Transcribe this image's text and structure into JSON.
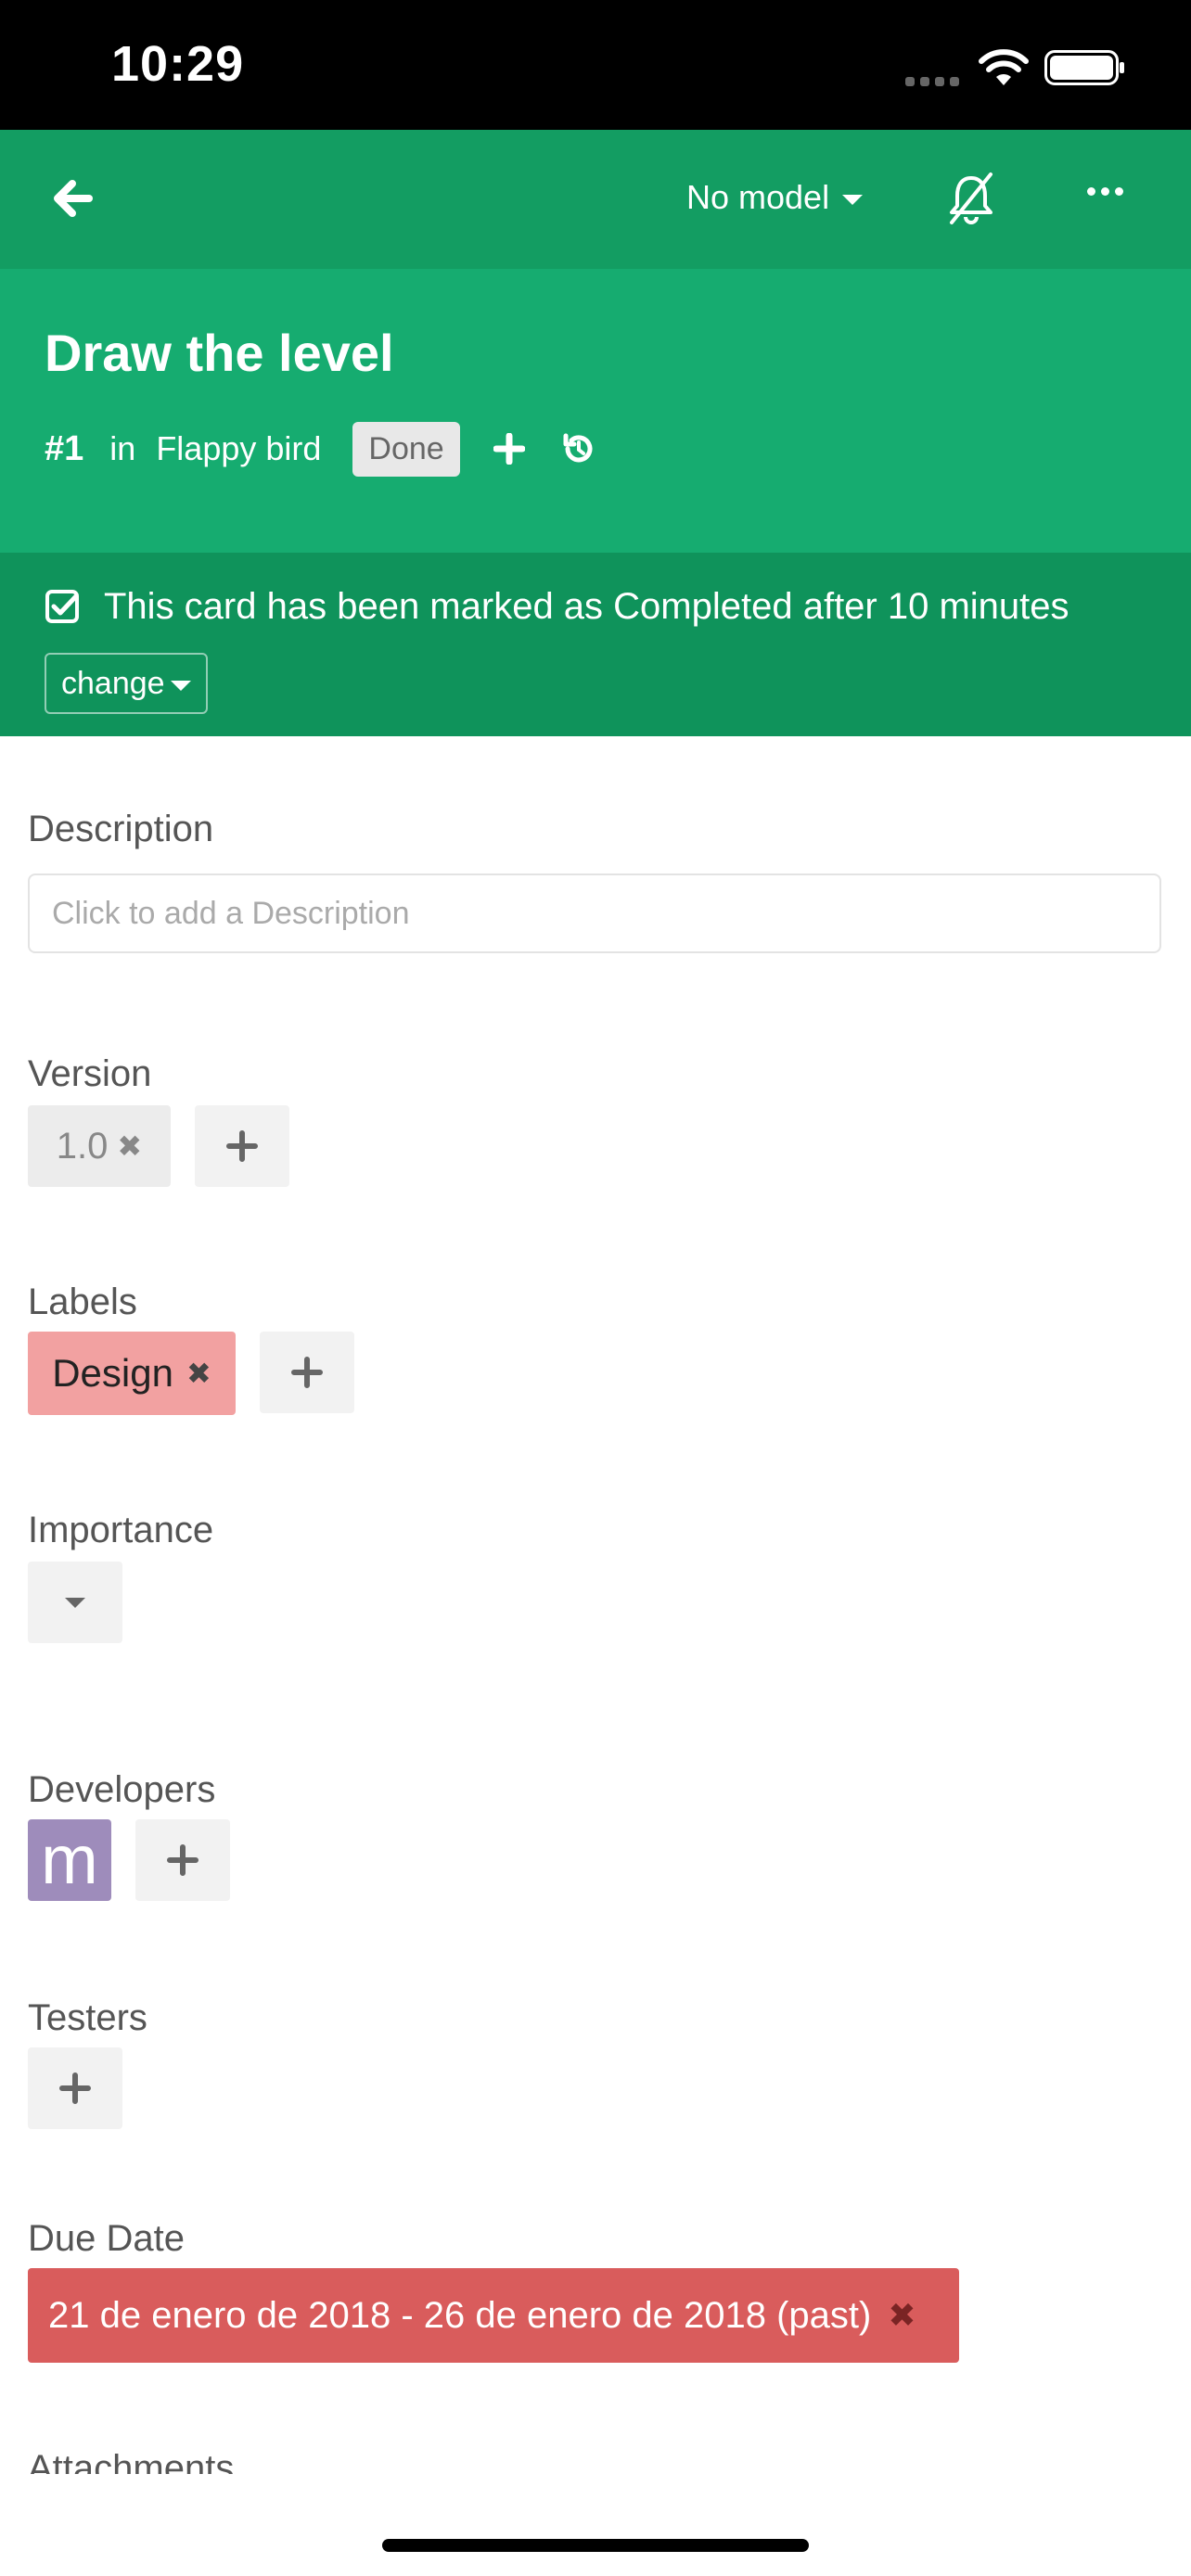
{
  "status_bar": {
    "time": "10:29"
  },
  "topbar": {
    "model_label": "No model"
  },
  "card": {
    "title": "Draw the level",
    "number": "#1",
    "in_label": "in",
    "project": "Flappy bird",
    "status": "Done"
  },
  "completed": {
    "message": "This card has been marked as Completed after 10 minutes",
    "change_label": "change"
  },
  "description": {
    "label": "Description",
    "placeholder": "Click to add a Description"
  },
  "version": {
    "label": "Version",
    "value": "1.0"
  },
  "labels": {
    "label": "Labels",
    "items": [
      "Design"
    ]
  },
  "importance": {
    "label": "Importance"
  },
  "developers": {
    "label": "Developers",
    "avatar_initial": "m"
  },
  "testers": {
    "label": "Testers"
  },
  "due_date": {
    "label": "Due Date",
    "value": "21 de enero de 2018 - 26 de enero de 2018 (past)"
  },
  "attachments": {
    "label": "Attachments"
  },
  "colors": {
    "topbar": "#139d62",
    "header": "#16ac70",
    "completed_banner": "#0f935b",
    "label_design": "#f2a1a1",
    "avatar": "#9e8cbb",
    "due_past": "#d95c5c"
  }
}
